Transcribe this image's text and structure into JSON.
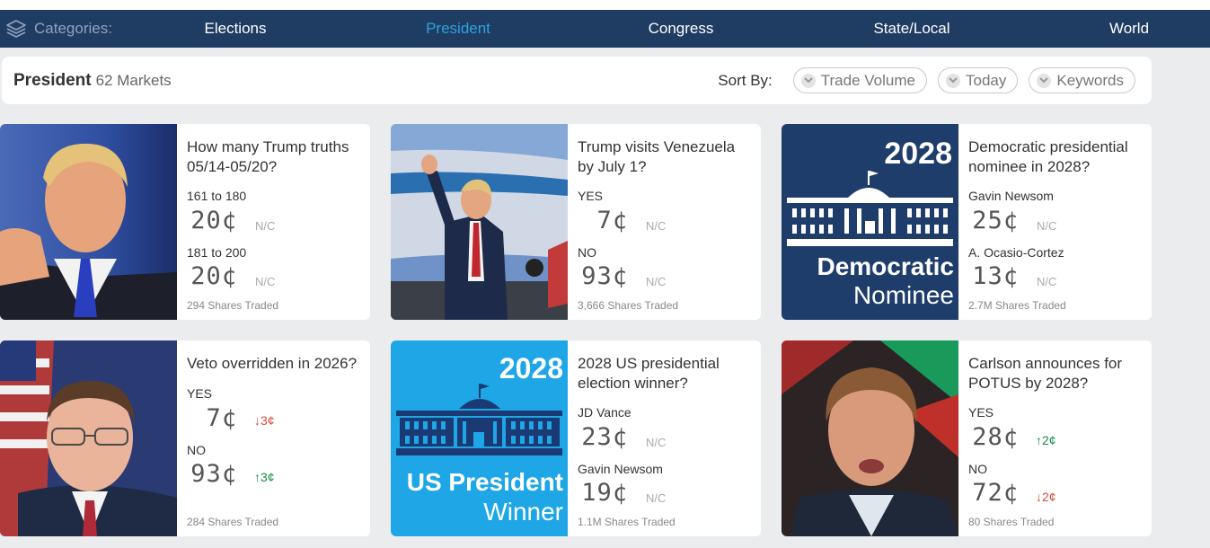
{
  "categories": {
    "label": "Categories:",
    "items": [
      "Elections",
      "President",
      "Congress",
      "State/Local",
      "World"
    ],
    "active": "President"
  },
  "header": {
    "title": "President",
    "count": "62 Markets",
    "sort_label": "Sort By:",
    "sort_options": [
      "Trade Volume",
      "Today",
      "Keywords"
    ]
  },
  "cards": [
    {
      "question_lines": [
        "How many Trump truths",
        "05/14-05/20?"
      ],
      "options": [
        {
          "label": "161 to 180",
          "price": "20¢",
          "change": "N/C",
          "trend": "none"
        },
        {
          "label": "181 to 200",
          "price": "20¢",
          "change": "N/C",
          "trend": "none"
        }
      ],
      "traded": "294 Shares Traded",
      "image": "trump-portrait"
    },
    {
      "question_lines": [
        "Trump visits Venezuela",
        "by July 1?"
      ],
      "options": [
        {
          "label": "YES",
          "price": "7¢",
          "change": "N/C",
          "trend": "none"
        },
        {
          "label": "NO",
          "price": "93¢",
          "change": "N/C",
          "trend": "none"
        }
      ],
      "traded": "3,666 Shares Traded",
      "image": "trump-airplane"
    },
    {
      "question_lines": [
        "Democratic presidential",
        "nominee in 2028?"
      ],
      "options": [
        {
          "label": "Gavin Newsom",
          "price": "25¢",
          "change": "N/C",
          "trend": "none"
        },
        {
          "label": "A. Ocasio-Cortez",
          "price": "13¢",
          "change": "N/C",
          "trend": "none"
        }
      ],
      "traded": "2.7M Shares Traded",
      "image": "democratic-nominee-graphic",
      "graphic": {
        "year": "2028",
        "line1": "Democratic",
        "line2": "Nominee",
        "bg": "#1e3d6b"
      }
    },
    {
      "question_lines": [
        "Veto overridden in 2026?"
      ],
      "options": [
        {
          "label": "YES",
          "price": "7¢",
          "change": "3¢",
          "trend": "down"
        },
        {
          "label": "NO",
          "price": "93¢",
          "change": "3¢",
          "trend": "up"
        }
      ],
      "traded": "284 Shares Traded",
      "image": "johnson-portrait"
    },
    {
      "question_lines": [
        "2028 US presidential",
        "election winner?"
      ],
      "options": [
        {
          "label": "JD Vance",
          "price": "23¢",
          "change": "N/C",
          "trend": "none"
        },
        {
          "label": "Gavin Newsom",
          "price": "19¢",
          "change": "N/C",
          "trend": "none"
        }
      ],
      "traded": "1.1M Shares Traded",
      "image": "us-president-winner-graphic",
      "graphic": {
        "year": "2028",
        "line1": "US President",
        "line2": "Winner",
        "bg": "#1ea6e6"
      }
    },
    {
      "question_lines": [
        "Carlson announces for",
        "POTUS by 2028?"
      ],
      "options": [
        {
          "label": "YES",
          "price": "28¢",
          "change": "2¢",
          "trend": "up"
        },
        {
          "label": "NO",
          "price": "72¢",
          "change": "2¢",
          "trend": "down"
        }
      ],
      "traded": "80 Shares Traded",
      "image": "carlson-portrait"
    }
  ],
  "colors": {
    "nav_bg": "#1f3c63",
    "nav_active": "#2ea3de",
    "up": "#1a8a4a",
    "down": "#d94a3a"
  }
}
